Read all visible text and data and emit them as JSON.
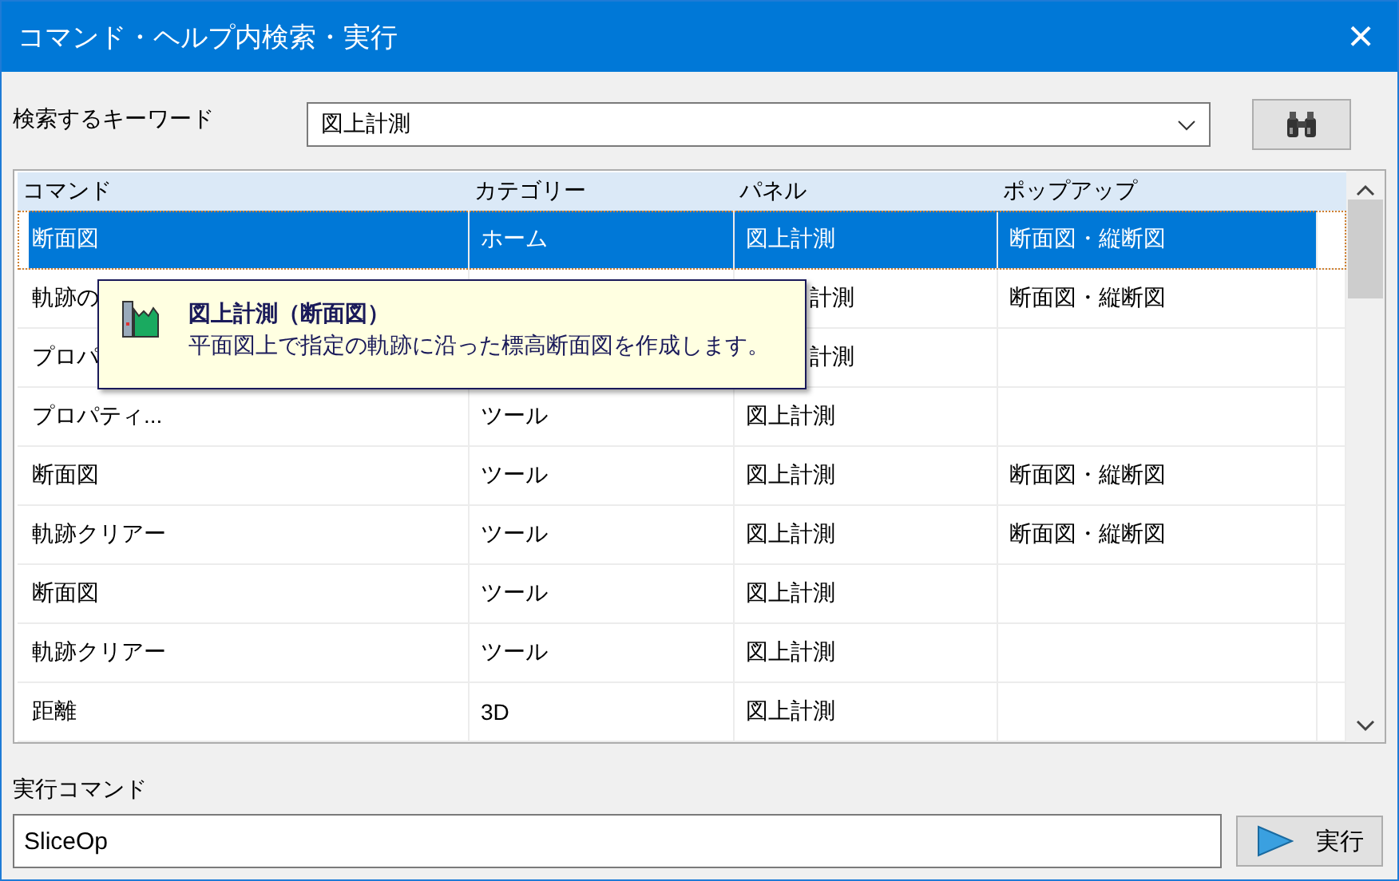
{
  "window": {
    "title": "コマンド・ヘルプ内検索・実行",
    "close": "×"
  },
  "search": {
    "label": "検索するキーワード",
    "value": "図上計測"
  },
  "table": {
    "columns": [
      "コマンド",
      "カテゴリー",
      "パネル",
      "ポップアップ"
    ],
    "rows": [
      {
        "command": "断面図",
        "category": "ホーム",
        "panel": "図上計測",
        "popup": "断面図・縦断図",
        "selected": true,
        "covered": false
      },
      {
        "command": "軌跡の",
        "panel": "計測",
        "popup": "断面図・縦断図",
        "selected": false,
        "covered": true
      },
      {
        "command": "プロパ",
        "panel": "計測",
        "selected": false,
        "covered": true
      },
      {
        "command": "プロパティ...",
        "category": "ツール",
        "panel": "図上計測",
        "selected": false,
        "covered": false
      },
      {
        "command": "断面図",
        "category": "ツール",
        "panel": "図上計測",
        "popup": "断面図・縦断図",
        "selected": false,
        "covered": false
      },
      {
        "command": "軌跡クリアー",
        "category": "ツール",
        "panel": "図上計測",
        "popup": "断面図・縦断図",
        "selected": false,
        "covered": false
      },
      {
        "command": "断面図",
        "category": "ツール",
        "panel": "図上計測",
        "selected": false,
        "covered": false
      },
      {
        "command": "軌跡クリアー",
        "category": "ツール",
        "panel": "図上計測",
        "selected": false,
        "covered": false
      },
      {
        "command": "距離",
        "category": "3D",
        "panel": "図上計測",
        "selected": false,
        "covered": false
      }
    ]
  },
  "tooltip": {
    "title": "図上計測（断面図）",
    "text": "平面図上で指定の軌跡に沿った標高断面図を作成します。"
  },
  "command": {
    "label": "実行コマンド",
    "value": "SliceOp",
    "button": "実行"
  }
}
